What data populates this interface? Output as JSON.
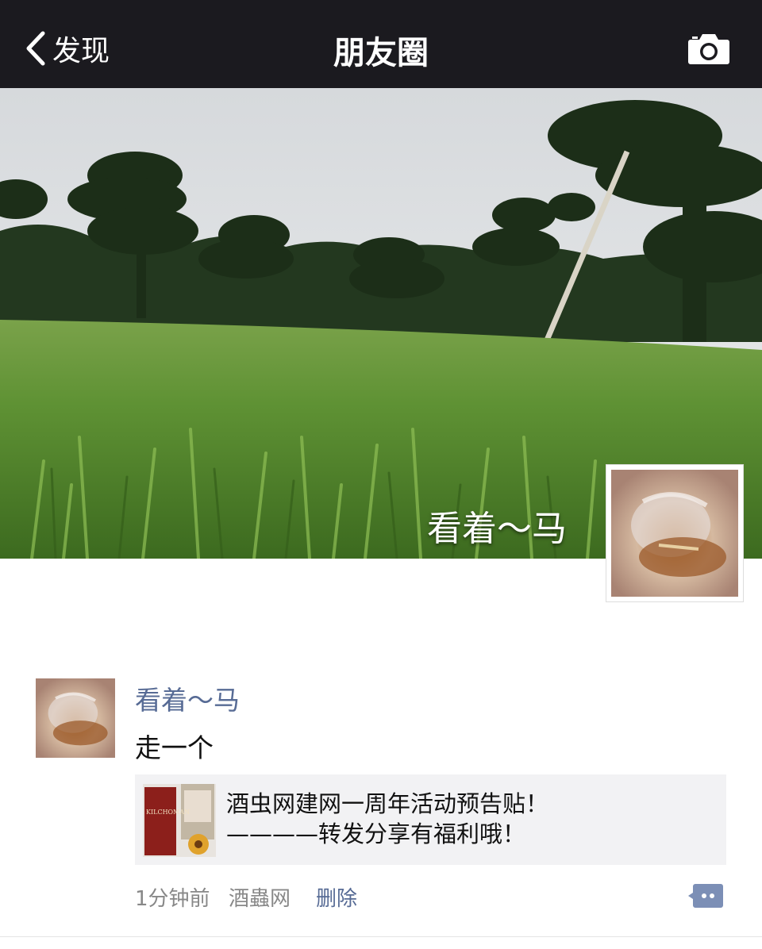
{
  "nav": {
    "back_label": "发现",
    "title": "朋友圈",
    "camera_icon": "camera-icon",
    "back_icon": "chevron-left-icon"
  },
  "cover": {
    "username": "看着～马"
  },
  "post": {
    "username": "看着～马",
    "text": "走一个",
    "share": {
      "line1": "酒虫网建网一周年活动预告贴！",
      "line2": "————转发分享有福利哦！",
      "thumb_text": "KILCHOMAN"
    },
    "time": "1分钟前",
    "source": "酒蟲网",
    "delete_label": "删除",
    "comment_icon": "comment-icon"
  },
  "colors": {
    "navbar_bg": "#1b1a1f",
    "link_blue": "#576b95",
    "card_bg": "#f2f2f4"
  }
}
